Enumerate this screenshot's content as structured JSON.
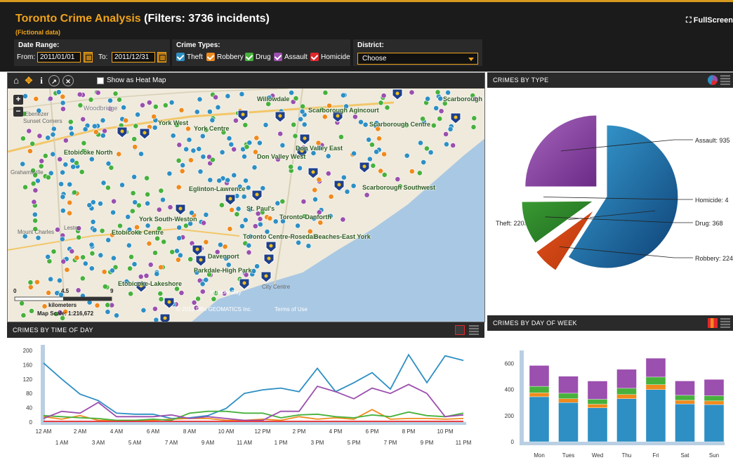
{
  "header": {
    "brand": "Toronto Crime Analysis",
    "filters_text": "(Filters: 3736  incidents)",
    "subtitle": "(Fictional data)",
    "fullscreen_label": "FullScreen",
    "date_range_label": "Date Range:",
    "from_label": "From:",
    "from_value": "2011/01/01",
    "to_label": "To:",
    "to_value": "2011/12/31",
    "crime_types_label": "Crime Types:",
    "crime_types": [
      {
        "label": "Theft",
        "color": "#2d8fc4"
      },
      {
        "label": "Robbery",
        "color": "#f08a1c"
      },
      {
        "label": "Drug",
        "color": "#47b13c"
      },
      {
        "label": "Assault",
        "color": "#9b4fae"
      },
      {
        "label": "Homicide",
        "color": "#e3262c"
      }
    ],
    "district_label": "District:",
    "district_value": "Choose"
  },
  "map": {
    "heat_map_label": "Show as Heat Map",
    "places": [
      "Woodbridge",
      "Willowdale",
      "Scarborough Agincourt",
      "Scarborough E",
      "York West",
      "York Centre",
      "Scarborough Centre",
      "Etobicoke North",
      "Don Valley East",
      "Don Valley West",
      "Eglinton-Lawrence",
      "Scarborough Southwest",
      "St. Paul's",
      "York South-Weston",
      "Toronto-Danforth",
      "Etobicoke Centre",
      "Toronto Centre-Rosedale",
      "Beaches-East York",
      "Davenport",
      "Parkdale-High Park",
      "Etobicoke-Lakeshore"
    ],
    "base_labels": [
      "Ebenezer",
      "Sunset Corners",
      "Grahamsville",
      "Mount Charles",
      "Humber Bay",
      "City Centre",
      "Lester"
    ],
    "scale_ticks": [
      "0",
      "4.5",
      "9"
    ],
    "scale_unit": "kilometers",
    "scale_text": "Map  Scale: 1:216,672",
    "copyright": "© 2013 DBx GEOMATICS Inc.",
    "terms": "Terms of Use"
  },
  "pie_panel": {
    "title": "CRIMES BY TYPE"
  },
  "dow_panel": {
    "title": "CRIMES BY DAY OF WEEK"
  },
  "tod_panel": {
    "title": "CRIMES BY TIME OF DAY"
  },
  "colors": {
    "theft": "#2d8fc4",
    "robbery": "#f08a1c",
    "drug": "#47b13c",
    "assault": "#9b4fae",
    "homicide": "#e3262c",
    "accent": "#f0a31a"
  },
  "chart_data": [
    {
      "type": "pie",
      "title": "CRIMES BY TYPE",
      "labels": [
        "Theft",
        "Robbery",
        "Drug",
        "Homicide",
        "Assault"
      ],
      "values": [
        2205,
        224,
        368,
        4,
        935
      ],
      "label_texts": [
        "Theft: 2205",
        "Robbery: 224",
        "Drug: 368",
        "Homicide: 4",
        "Assault: 935"
      ]
    },
    {
      "type": "bar",
      "title": "CRIMES BY DAY OF WEEK",
      "stacked": true,
      "categories": [
        "Mon",
        "Tues",
        "Wed",
        "Thu",
        "Fri",
        "Sat",
        "Sun"
      ],
      "ylim": [
        0,
        700
      ],
      "yticks": [
        0,
        200,
        400,
        600
      ],
      "series": [
        {
          "name": "Theft",
          "values": [
            345,
            300,
            260,
            330,
            400,
            290,
            285
          ]
        },
        {
          "name": "Robbery",
          "values": [
            30,
            30,
            28,
            32,
            38,
            28,
            28
          ]
        },
        {
          "name": "Drug",
          "values": [
            50,
            42,
            38,
            48,
            58,
            38,
            40
          ]
        },
        {
          "name": "Assault",
          "values": [
            160,
            130,
            140,
            145,
            145,
            110,
            125
          ]
        },
        {
          "name": "Homicide",
          "values": [
            1,
            0,
            1,
            0,
            1,
            0,
            1
          ]
        }
      ]
    },
    {
      "type": "line",
      "title": "CRIMES BY TIME OF DAY",
      "ylim": [
        0,
        200
      ],
      "yticks": [
        0,
        20,
        40,
        60,
        80,
        100,
        120,
        140,
        160,
        180,
        200
      ],
      "x_labels": [
        "12 AM",
        "1 AM",
        "2 AM",
        "3 AM",
        "4 AM",
        "5 AM",
        "6 AM",
        "7 AM",
        "8 AM",
        "9 AM",
        "10 AM",
        "11 AM",
        "12 PM",
        "1 PM",
        "2 PM",
        "3 PM",
        "4 PM",
        "5 PM",
        "6 PM",
        "7 PM",
        "8 PM",
        "9 PM",
        "10 PM",
        "11 PM"
      ],
      "series": [
        {
          "name": "Theft",
          "values": [
            165,
            120,
            78,
            60,
            25,
            22,
            22,
            10,
            12,
            18,
            38,
            80,
            90,
            95,
            85,
            150,
            85,
            110,
            138,
            92,
            188,
            110,
            185,
            172
          ]
        },
        {
          "name": "Robbery",
          "values": [
            15,
            8,
            18,
            5,
            5,
            5,
            5,
            8,
            10,
            10,
            5,
            5,
            8,
            5,
            15,
            8,
            12,
            8,
            35,
            8,
            10,
            10,
            8,
            10
          ]
        },
        {
          "name": "Drug",
          "values": [
            18,
            15,
            12,
            10,
            5,
            5,
            8,
            5,
            25,
            30,
            30,
            25,
            25,
            12,
            20,
            22,
            15,
            12,
            20,
            15,
            28,
            18,
            15,
            25
          ]
        },
        {
          "name": "Assault",
          "values": [
            10,
            30,
            25,
            55,
            15,
            15,
            15,
            20,
            10,
            15,
            10,
            5,
            5,
            30,
            30,
            100,
            85,
            65,
            95,
            80,
            105,
            80,
            15,
            20
          ]
        },
        {
          "name": "Homicide",
          "values": [
            2,
            2,
            2,
            2,
            2,
            2,
            2,
            2,
            2,
            2,
            2,
            2,
            2,
            2,
            2,
            2,
            2,
            2,
            2,
            2,
            2,
            2,
            2,
            2
          ]
        }
      ]
    }
  ]
}
